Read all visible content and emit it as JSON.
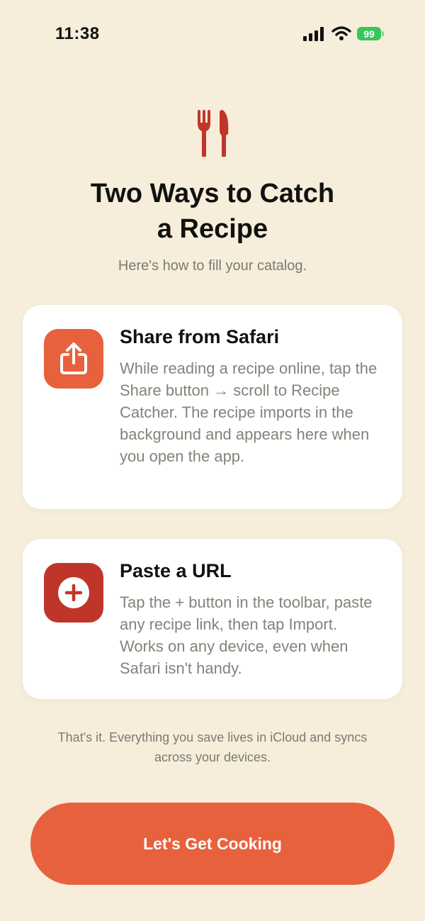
{
  "status_bar": {
    "time": "11:38",
    "battery_level": "99",
    "icons": [
      "cellular-signal-icon",
      "wifi-icon",
      "battery-charging-icon"
    ]
  },
  "header": {
    "icon": "fork-knife-icon",
    "title_line_1": "Two Ways to Catch",
    "title_line_2": "a Recipe",
    "subtitle": "Here's how to fill your catalog."
  },
  "cards": [
    {
      "icon": "share-icon",
      "title": "Share from Safari",
      "body": "While reading a recipe online, tap the Share button → scroll to Recipe Catcher. The recipe imports in the background and appears here when you open the app."
    },
    {
      "icon": "plus-circle-icon",
      "title": "Paste a URL",
      "body": "Tap the + button in the toolbar, paste any recipe link, then tap Import. Works on any device, even when Safari isn't handy."
    }
  ],
  "footer_note": "That's it. Everything you save lives in iCloud and syncs across your devices.",
  "cta_label": "Let's Get Cooking",
  "colors": {
    "background": "#f6eddb",
    "accent": "#e8613d",
    "accent_dark": "#c0352a",
    "icon_red": "#c0352a",
    "battery_green": "#34c759"
  }
}
